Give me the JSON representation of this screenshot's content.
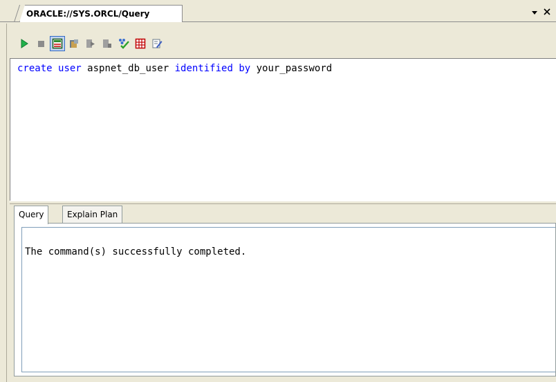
{
  "document_tab": {
    "title": "ORACLE://SYS.ORCL/Query",
    "dropdown_icon": "chevron-down-icon",
    "close_icon": "close-icon"
  },
  "toolbar": {
    "buttons": [
      {
        "name": "execute-button",
        "icon": "play-icon"
      },
      {
        "name": "stop-button",
        "icon": "stop-icon"
      },
      {
        "name": "results-to-grid-button",
        "icon": "results-grid-icon",
        "pressed": true
      },
      {
        "name": "open-query-button",
        "icon": "folder-icon"
      },
      {
        "name": "step-into-button",
        "icon": "step-icon"
      },
      {
        "name": "bookmark-button",
        "icon": "bookmark-icon"
      },
      {
        "name": "query-designer-button",
        "icon": "designer-icon"
      },
      {
        "name": "table-view-button",
        "icon": "table-icon"
      },
      {
        "name": "edit-button",
        "icon": "edit-icon"
      }
    ]
  },
  "editor": {
    "code_tokens": [
      {
        "text": "create",
        "kw": true
      },
      {
        "text": " ",
        "kw": false
      },
      {
        "text": "user",
        "kw": true
      },
      {
        "text": " aspnet_db_user ",
        "kw": false
      },
      {
        "text": "identified",
        "kw": true
      },
      {
        "text": " ",
        "kw": false
      },
      {
        "text": "by",
        "kw": true
      },
      {
        "text": " your_password",
        "kw": false
      }
    ]
  },
  "results": {
    "tabs": [
      {
        "label": "Query",
        "active": true
      },
      {
        "label": "Explain Plan",
        "active": false
      }
    ],
    "message": "The command(s) successfully completed."
  },
  "colors": {
    "keyword": "#0000ff",
    "play": "#22b14c",
    "stop": "#8c8c8c",
    "grid": "#c00000"
  }
}
